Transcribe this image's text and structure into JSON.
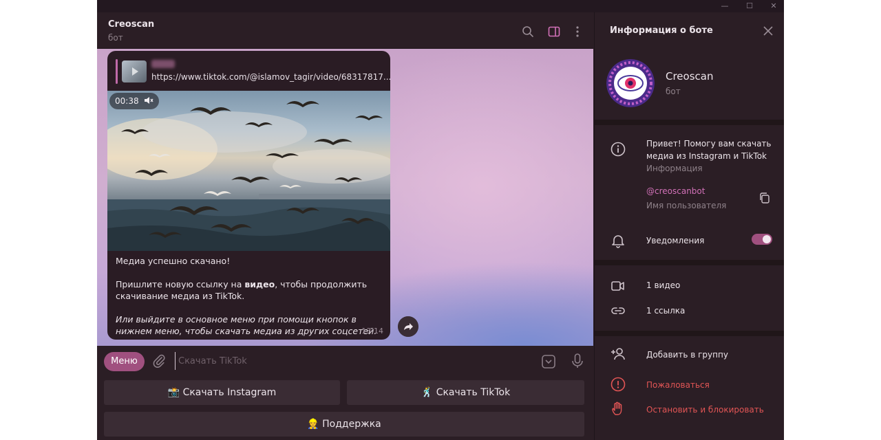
{
  "window": {
    "minimize": "—",
    "maximize": "☐",
    "close": "✕"
  },
  "chat": {
    "title": "Creoscan",
    "subtitle": "бот"
  },
  "message": {
    "reply_url": "https://www.tiktok.com/@islamov_tagir/video/68317817...",
    "video_duration": "00:38",
    "line1": "Медиа успешно скачано!",
    "line2_before": "Пришлите новую ссылку на ",
    "line2_bold": "видео",
    "line2_after": ", чтобы продолжить скачивание медиа из TikTok.",
    "line3": "Или выйдите в основное меню при помощи кнопок в нижнем меню, чтобы скачать медиа из других соцсетей.",
    "time": "13:14"
  },
  "input": {
    "menu_label": "Меню",
    "placeholder": "Скачать TikTok"
  },
  "keyboard": {
    "instagram": "📸 Скачать Instagram",
    "tiktok": "🕺 Скачать TikTok",
    "support": "👷 Поддержка"
  },
  "info": {
    "title": "Информация о боте",
    "bot_name": "Creoscan",
    "bot_sub": "бот",
    "about_text_1": "Привет! Помогу вам скачать",
    "about_text_2": "медиа из Instagram и TikTok",
    "about_label": "Информация",
    "username": "@creoscanbot",
    "username_label": "Имя пользователя",
    "notifications": "Уведомления",
    "notifications_on": true,
    "videos": "1 видео",
    "links": "1 ссылка",
    "add_group": "Добавить в группу",
    "report": "Пожаловаться",
    "stop_block": "Остановить и блокировать"
  },
  "colors": {
    "accent": "#a0507f",
    "danger": "#e25555",
    "link": "#d271b8"
  }
}
